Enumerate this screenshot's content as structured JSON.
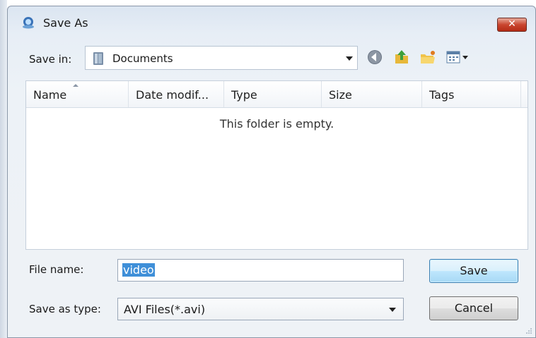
{
  "window": {
    "title": "Save As",
    "close_label": "✕"
  },
  "toolbar": {
    "save_in_label": "Save in:",
    "location": "Documents",
    "icons": [
      "back-icon",
      "up-folder-icon",
      "new-folder-icon",
      "views-menu-icon"
    ]
  },
  "file_list": {
    "columns": [
      "Name",
      "Date modif...",
      "Type",
      "Size",
      "Tags"
    ],
    "sorted_column": "Name",
    "empty_message": "This folder is empty."
  },
  "form": {
    "filename_label": "File name:",
    "filename_value": "video",
    "type_label": "Save as type:",
    "type_value": "AVI Files(*.avi)"
  },
  "buttons": {
    "save": "Save",
    "cancel": "Cancel"
  },
  "colors": {
    "selection": "#3f8fd8",
    "close_button": "#c9452f",
    "default_button_border": "#3c7fb1"
  }
}
